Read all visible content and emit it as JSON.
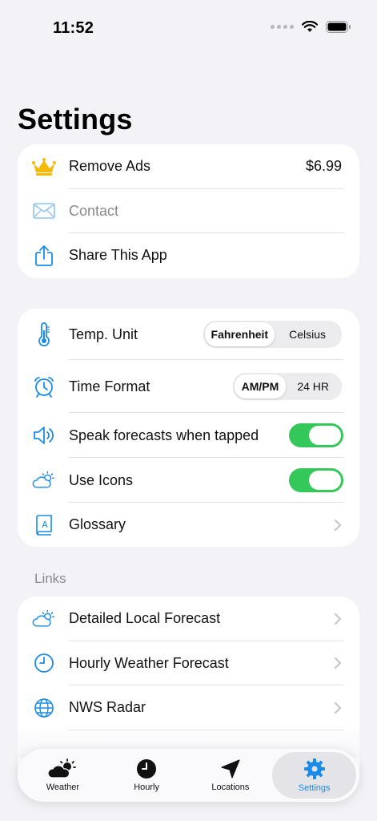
{
  "status": {
    "time": "11:52"
  },
  "page": {
    "title": "Settings"
  },
  "colors": {
    "accent": "#1a8be8",
    "toggle_on": "#34c759",
    "crown": "#f5b900"
  },
  "general": {
    "items": [
      {
        "label": "Remove Ads",
        "value": "$6.99",
        "icon": "crown-icon"
      },
      {
        "label": "Contact",
        "icon": "envelope-icon"
      },
      {
        "label": "Share This App",
        "icon": "share-icon"
      }
    ]
  },
  "preferences": {
    "temp_unit": {
      "label": "Temp. Unit",
      "options": [
        "Fahrenheit",
        "Celsius"
      ],
      "selected": "Fahrenheit"
    },
    "time_format": {
      "label": "Time Format",
      "options": [
        "AM/PM",
        "24 HR"
      ],
      "selected": "AM/PM"
    },
    "speak": {
      "label": "Speak forecasts when tapped",
      "on": true
    },
    "use_icons": {
      "label": "Use Icons",
      "on": true
    },
    "glossary": {
      "label": "Glossary"
    }
  },
  "links": {
    "header": "Links",
    "items": [
      {
        "label": "Detailed Local Forecast",
        "icon": "partly-cloudy-icon"
      },
      {
        "label": "Hourly Weather Forecast",
        "icon": "clock-icon"
      },
      {
        "label": "NWS Radar",
        "icon": "globe-icon"
      }
    ]
  },
  "tabs": [
    {
      "label": "Weather",
      "icon": "weather-icon"
    },
    {
      "label": "Hourly",
      "icon": "clock-icon"
    },
    {
      "label": "Locations",
      "icon": "location-arrow-icon"
    },
    {
      "label": "Settings",
      "icon": "gear-icon",
      "active": true
    }
  ]
}
